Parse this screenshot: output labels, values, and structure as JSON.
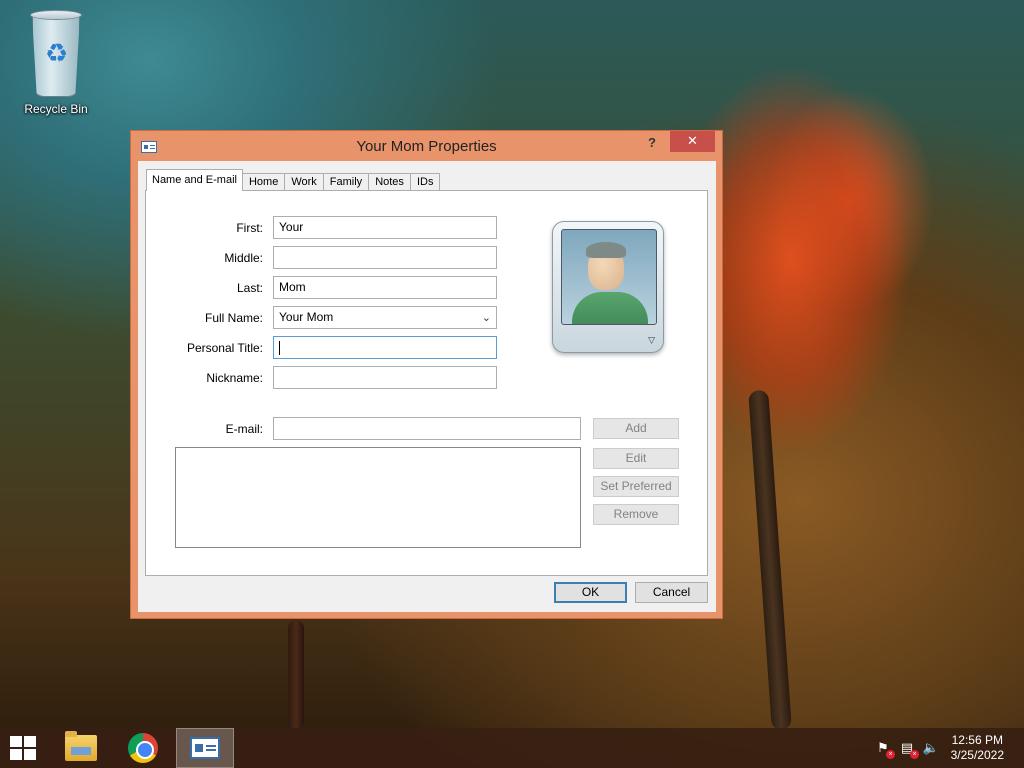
{
  "desktop": {
    "icons": [
      {
        "label": "Recycle Bin",
        "icon": "recycle-bin-icon"
      }
    ]
  },
  "window": {
    "title": "Your Mom Properties",
    "help_label": "?",
    "close_label": "✕",
    "tabs": [
      {
        "label": "Name and E-mail",
        "active": true
      },
      {
        "label": "Home",
        "active": false
      },
      {
        "label": "Work",
        "active": false
      },
      {
        "label": "Family",
        "active": false
      },
      {
        "label": "Notes",
        "active": false
      },
      {
        "label": "IDs",
        "active": false
      }
    ],
    "form": {
      "first": {
        "label": "First:",
        "value": "Your"
      },
      "middle": {
        "label": "Middle:",
        "value": ""
      },
      "last": {
        "label": "Last:",
        "value": "Mom"
      },
      "full_name": {
        "label": "Full Name:",
        "value": "Your Mom"
      },
      "personal_title": {
        "label": "Personal Title:",
        "value": ""
      },
      "nickname": {
        "label": "Nickname:",
        "value": ""
      },
      "email": {
        "label": "E-mail:",
        "value": ""
      }
    },
    "email_buttons": {
      "add": "Add",
      "edit": "Edit",
      "set_preferred": "Set Preferred",
      "remove": "Remove"
    },
    "footer": {
      "ok": "OK",
      "cancel": "Cancel"
    }
  },
  "taskbar": {
    "items": [
      {
        "name": "file-explorer",
        "icon": "folder-icon"
      },
      {
        "name": "chrome",
        "icon": "chrome-icon"
      },
      {
        "name": "contacts",
        "icon": "contact-card-icon",
        "active": true
      }
    ],
    "tray_icons": [
      "flag-alert-icon",
      "network-alert-icon",
      "volume-muted-icon"
    ],
    "clock": {
      "time": "12:56 PM",
      "date": "3/25/2022"
    }
  },
  "colors": {
    "window_frame": "#e9936a",
    "close_button": "#c7504b",
    "focus_border": "#5b9bd5",
    "taskbar": "#372012"
  }
}
